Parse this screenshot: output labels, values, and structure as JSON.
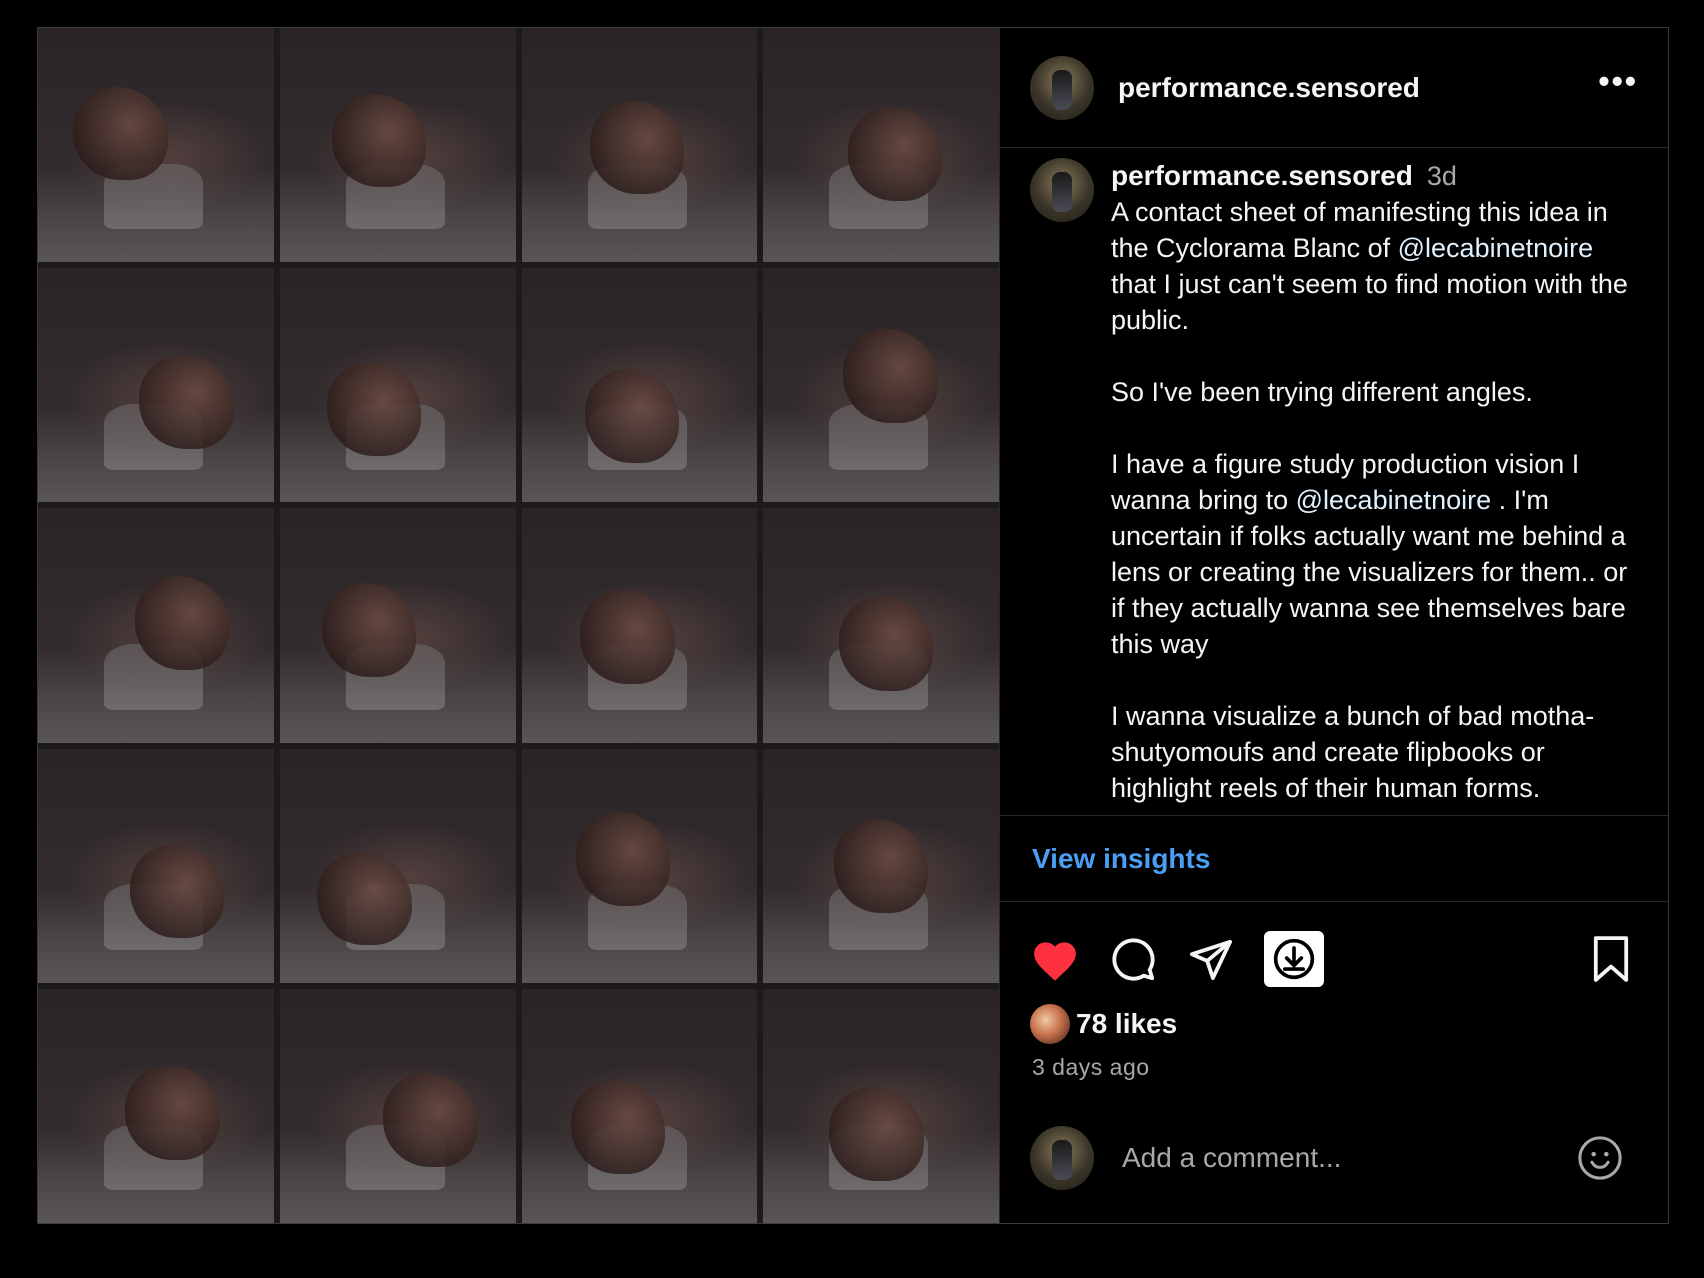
{
  "header": {
    "username": "performance.sensored",
    "more_label": "•••"
  },
  "media": {
    "frame_count": 20,
    "alt": "contact sheet"
  },
  "caption": {
    "username": "performance.sensored",
    "time": "3d",
    "text_before_mention1": "A contact sheet of manifesting this idea in the Cyclorama Blanc of ",
    "mention1": "@lecabinetnoire",
    "text_after_mention1": " that I just can't seem to find motion with the public.\n\nSo I've been trying different angles.\n\nI have a figure study production vision I wanna bring to ",
    "mention2": "@lecabinetnoire",
    "text_after_mention2": " . I'm uncertain if folks actually want me behind a lens or creating the visualizers for them.. or if they actually wanna see themselves bare this way\n\nI wanna visualize a bunch of bad motha-shutyomoufs and create flipbooks or highlight reels of their human forms."
  },
  "insights": {
    "label": "View insights"
  },
  "actions": {
    "like_icon": "heart-filled-icon",
    "comment_icon": "comment-icon",
    "share_icon": "share-icon",
    "download_icon": "download-icon",
    "save_icon": "bookmark-icon",
    "like_color": "#ff3040"
  },
  "stats": {
    "likes": "78 likes",
    "ago": "3 days ago"
  },
  "comment": {
    "placeholder": "Add a comment..."
  },
  "colors": {
    "background": "#000000",
    "link": "#4a9ff5",
    "muted": "#a8a8a8",
    "text": "#f5f5f5"
  }
}
